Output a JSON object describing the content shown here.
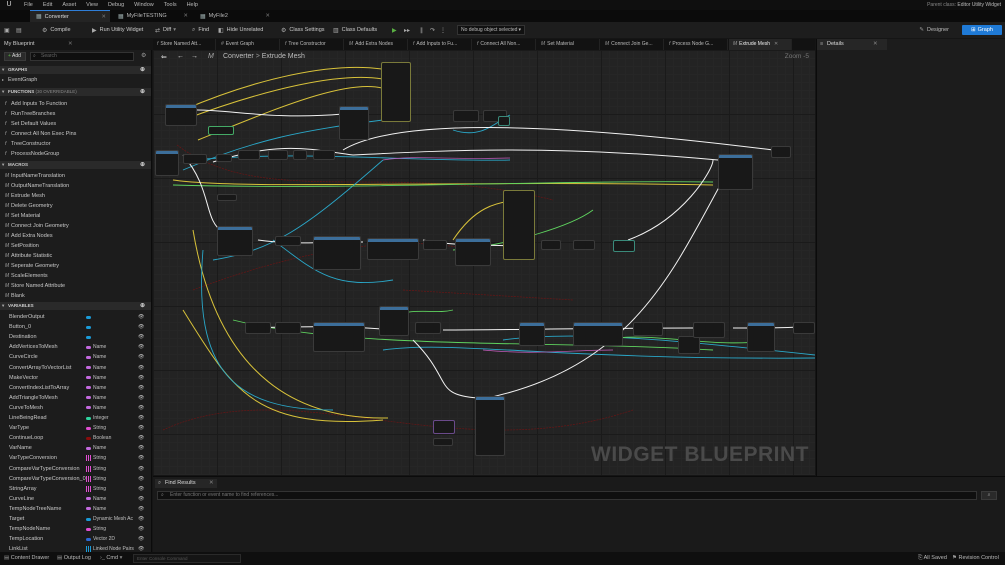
{
  "menubar": {
    "logo": "U",
    "items": [
      "File",
      "Edit",
      "Asset",
      "View",
      "Debug",
      "Window",
      "Tools",
      "Help"
    ],
    "parent_class_label": "Parent class:",
    "parent_class_value": "Editor Utility Widget"
  },
  "doc_tabs": [
    {
      "label": "Converter",
      "icon": "blueprint-icon",
      "active": true
    },
    {
      "label": "MyFileTESTING",
      "icon": "blueprint-icon",
      "active": false
    },
    {
      "label": "MyFile2",
      "icon": "blueprint-icon",
      "active": false
    }
  ],
  "toolbar": {
    "compile": "Compile",
    "run_utility": "Run Utility Widget",
    "diff": "Diff",
    "find": "Find",
    "hide_unrelated": "Hide Unrelated",
    "class_settings": "Class Settings",
    "class_defaults": "Class Defaults",
    "debug_select": "No debug object selected",
    "designer": "Designer",
    "graph": "Graph",
    "accent_color": "#1f7ad6"
  },
  "my_blueprint": {
    "tab_label": "My Blueprint",
    "add_label": "Add",
    "search_placeholder": "Search",
    "graphs_header": "GRAPHS",
    "graphs": [
      "EventGraph"
    ],
    "functions_header": "FUNCTIONS",
    "functions_sub": "(30 OVERRIDABLE)",
    "functions": [
      "Add Inputs To Function",
      "RunTreeBranches",
      "Set Default Values",
      "Connect All Non Exec Pins",
      "TreeConstructor",
      "ProcessNodeGroup"
    ],
    "macros_header": "MACROS",
    "macros": [
      "InputNameTranslation",
      "OutputNameTranslation",
      "Extrude Mesh",
      "Delete Geometry",
      "Set Material",
      "Connect Join Geometry",
      "Add Extra Nodes",
      "SetPosition",
      "Attribute Statistic",
      "Seperate Geometry",
      "ScaleElements",
      "Store Named Attribute",
      "Blank"
    ],
    "variables_header": "VARIABLES",
    "variables": [
      {
        "name": "BlenderOutput",
        "type": "",
        "color": "#1a9bd8",
        "array": false
      },
      {
        "name": "Button_0",
        "type": "",
        "color": "#1a9bd8",
        "array": false
      },
      {
        "name": "Destination",
        "type": "",
        "color": "#1a9bd8",
        "array": false
      },
      {
        "name": "AddVerticesToMesh",
        "type": "Name",
        "color": "#c46adf",
        "array": false
      },
      {
        "name": "CurveCircle",
        "type": "Name",
        "color": "#c46adf",
        "array": false
      },
      {
        "name": "ConvertArrayToVectorList",
        "type": "Name",
        "color": "#c46adf",
        "array": false
      },
      {
        "name": "MakeVector",
        "type": "Name",
        "color": "#c46adf",
        "array": false
      },
      {
        "name": "ConvertIndexListToArray",
        "type": "Name",
        "color": "#c46adf",
        "array": false
      },
      {
        "name": "AddTriangleToMesh",
        "type": "Name",
        "color": "#c46adf",
        "array": false
      },
      {
        "name": "CurveToMesh",
        "type": "Name",
        "color": "#c46adf",
        "array": false
      },
      {
        "name": "LineBeingRead",
        "type": "Integer",
        "color": "#2fd5a0",
        "array": false
      },
      {
        "name": "VarType",
        "type": "String",
        "color": "#e14ed2",
        "array": false
      },
      {
        "name": "ContinueLoop",
        "type": "Boolean",
        "color": "#8a0d0d",
        "array": false
      },
      {
        "name": "VarName",
        "type": "Name",
        "color": "#c46adf",
        "array": false
      },
      {
        "name": "VarTypeConversion",
        "type": "String",
        "color": "#e14ed2",
        "array": true
      },
      {
        "name": "CompareVarTypeConversion",
        "type": "String",
        "color": "#e14ed2",
        "array": true
      },
      {
        "name": "CompareVarTypeConversion_0",
        "type": "String",
        "color": "#e14ed2",
        "array": true
      },
      {
        "name": "StringArray",
        "type": "String",
        "color": "#e14ed2",
        "array": true
      },
      {
        "name": "CurveLine",
        "type": "Name",
        "color": "#c46adf",
        "array": false
      },
      {
        "name": "TempNodeTreeName",
        "type": "Name",
        "color": "#c46adf",
        "array": false
      },
      {
        "name": "Target",
        "type": "Dynamic Mesh Ac",
        "color": "#1a9bd8",
        "array": false
      },
      {
        "name": "TempNodeName",
        "type": "String",
        "color": "#e14ed2",
        "array": false
      },
      {
        "name": "TempLocation",
        "type": "Vector 2D",
        "color": "#2a6ad8",
        "array": false
      },
      {
        "name": "LinkList",
        "type": "Linked Node Pairs",
        "color": "#1a9bd8",
        "array": true
      }
    ]
  },
  "graph_tabs": [
    {
      "label": "Store Named Att...",
      "icon": "f"
    },
    {
      "label": "Event Graph",
      "icon": "#"
    },
    {
      "label": "Tree Constructor",
      "icon": "f"
    },
    {
      "label": "Add Extra Nodes",
      "icon": "M"
    },
    {
      "label": "Add Inputs to Fu...",
      "icon": "f"
    },
    {
      "label": "Connect All Non...",
      "icon": "f"
    },
    {
      "label": "Set Material",
      "icon": "M"
    },
    {
      "label": "Connect Join Ge...",
      "icon": "M"
    },
    {
      "label": "Process Node G...",
      "icon": "f"
    },
    {
      "label": "Extrude Mesh",
      "icon": "M",
      "active": true
    }
  ],
  "graph": {
    "breadcrumb_root": "Converter",
    "breadcrumb_sep": ">",
    "breadcrumb_current": "Extrude Mesh",
    "zoom": "Zoom -5",
    "watermark": "WIDGET BLUEPRINT"
  },
  "details": {
    "tab_label": "Details"
  },
  "find_results": {
    "tab_label": "Find Results",
    "placeholder": "Enter function or event name to find references..."
  },
  "statusbar": {
    "content_drawer": "Content Drawer",
    "output_log": "Output Log",
    "cmd": "Cmd",
    "cmd_placeholder": "Enter Console Command",
    "all_saved": "All Saved",
    "revision_control": "Revision Control"
  }
}
